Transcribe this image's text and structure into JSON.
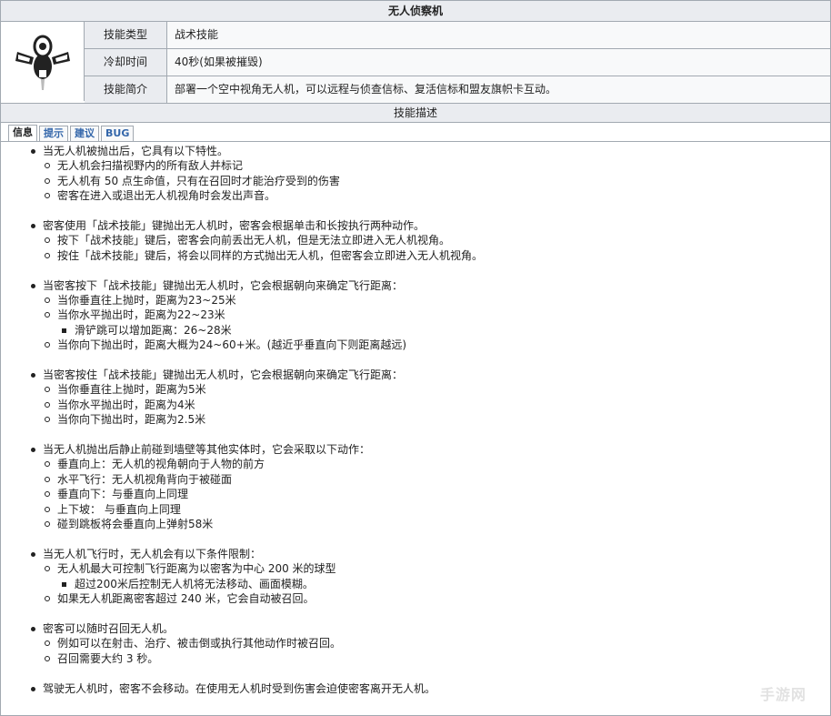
{
  "title": "无人侦察机",
  "info": {
    "rows": [
      {
        "label": "技能类型",
        "value": "战术技能"
      },
      {
        "label": "冷却时间",
        "value": "40秒(如果被摧毁)"
      },
      {
        "label": "技能简介",
        "value": "部署一个空中视角无人机，可以远程与侦查信标、复活信标和盟友旗帜卡互动。"
      }
    ]
  },
  "section_title": "技能描述",
  "tabs": [
    "信息",
    "提示",
    "建议",
    "BUG"
  ],
  "groups": [
    {
      "text": "当无人机被抛出后，它具有以下特性。",
      "items": [
        {
          "text": "无人机会扫描视野内的所有敌人并标记"
        },
        {
          "text": "无人机有 50 点生命值，只有在召回时才能治疗受到的伤害"
        },
        {
          "text": "密客在进入或退出无人机视角时会发出声音。"
        }
      ]
    },
    {
      "text": "密客使用「战术技能」键抛出无人机时，密客会根据单击和长按执行两种动作。",
      "items": [
        {
          "text": "按下「战术技能」键后，密客会向前丢出无人机，但是无法立即进入无人机视角。"
        },
        {
          "text": "按住「战术技能」键后，将会以同样的方式抛出无人机，但密客会立即进入无人机视角。"
        }
      ]
    },
    {
      "text": "当密客按下「战术技能」键抛出无人机时，它会根据朝向来确定飞行距离：",
      "items": [
        {
          "text": "当你垂直往上抛时，距离为23~25米"
        },
        {
          "text": "当你水平抛出时，距离为22~23米",
          "sub": [
            "滑铲跳可以增加距离：26~28米"
          ]
        },
        {
          "text": "当你向下抛出时，距离大概为24~60+米。(越近乎垂直向下则距离越远)"
        }
      ]
    },
    {
      "text": "当密客按住「战术技能」键抛出无人机时，它会根据朝向来确定飞行距离：",
      "items": [
        {
          "text": "当你垂直往上抛时，距离为5米"
        },
        {
          "text": "当你水平抛出时，距离为4米"
        },
        {
          "text": "当你向下抛出时，距离为2.5米"
        }
      ]
    },
    {
      "text": "当无人机抛出后静止前碰到墙壁等其他实体时，它会采取以下动作：",
      "items": [
        {
          "text": "垂直向上：无人机的视角朝向于人物的前方"
        },
        {
          "text": "水平飞行：无人机视角背向于被碰面"
        },
        {
          "text": "垂直向下：与垂直向上同理"
        },
        {
          "text": "上下坡：    与垂直向上同理"
        },
        {
          "text": "碰到跳板将会垂直向上弹射58米"
        }
      ]
    },
    {
      "text": "当无人机飞行时，无人机会有以下条件限制：",
      "items": [
        {
          "text": "无人机最大可控制飞行距离为以密客为中心 200 米的球型",
          "sub": [
            "超过200米后控制无人机将无法移动、画面模糊。"
          ]
        },
        {
          "text": "如果无人机距离密客超过 240 米，它会自动被召回。"
        }
      ]
    },
    {
      "text": "密客可以随时召回无人机。",
      "items": [
        {
          "text": "例如可以在射击、治疗、被击倒或执行其他动作时被召回。"
        },
        {
          "text": "召回需要大约 3 秒。"
        }
      ]
    },
    {
      "text": "驾驶无人机时，密客不会移动。在使用无人机时受到伤害会迫使密客离开无人机。",
      "items": []
    }
  ],
  "watermark": "手游网"
}
